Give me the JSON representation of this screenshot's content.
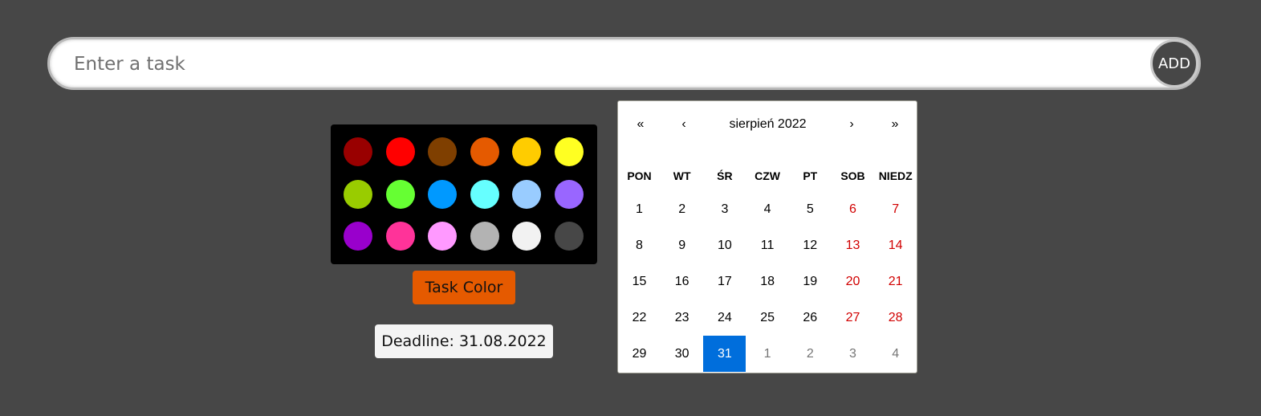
{
  "task": {
    "placeholder": "Enter a task",
    "add_label": "ADD"
  },
  "palette": {
    "colors": [
      [
        "#990000",
        "#ff0000",
        "#7f3f00",
        "#e55a00",
        "#ffcc00",
        "#ffff22"
      ],
      [
        "#99cc00",
        "#66ff33",
        "#0099ff",
        "#66ffff",
        "#99ccff",
        "#9966ff"
      ],
      [
        "#9900cc",
        "#ff3399",
        "#ff99ff",
        "#b3b3b3",
        "#f2f2f2",
        "#474747"
      ]
    ],
    "task_color_label": "Task Color",
    "deadline_label": "Deadline: 31.08.2022"
  },
  "calendar": {
    "prev2": "«",
    "prev": "‹",
    "month_label": "sierpień 2022",
    "next": "›",
    "next2": "»",
    "weekdays": [
      "PON",
      "WT",
      "ŚR",
      "CZW",
      "PT",
      "SOB",
      "NIEDZ"
    ],
    "weeks": [
      [
        "1",
        "2",
        "3",
        "4",
        "5",
        "6",
        "7"
      ],
      [
        "8",
        "9",
        "10",
        "11",
        "12",
        "13",
        "14"
      ],
      [
        "15",
        "16",
        "17",
        "18",
        "19",
        "20",
        "21"
      ],
      [
        "22",
        "23",
        "24",
        "25",
        "26",
        "27",
        "28"
      ],
      [
        "29",
        "30",
        "31",
        "1",
        "2",
        "3",
        "4"
      ]
    ],
    "selected_day": "31",
    "accent_color": "#006edc",
    "weekend_color": "#d10000"
  }
}
